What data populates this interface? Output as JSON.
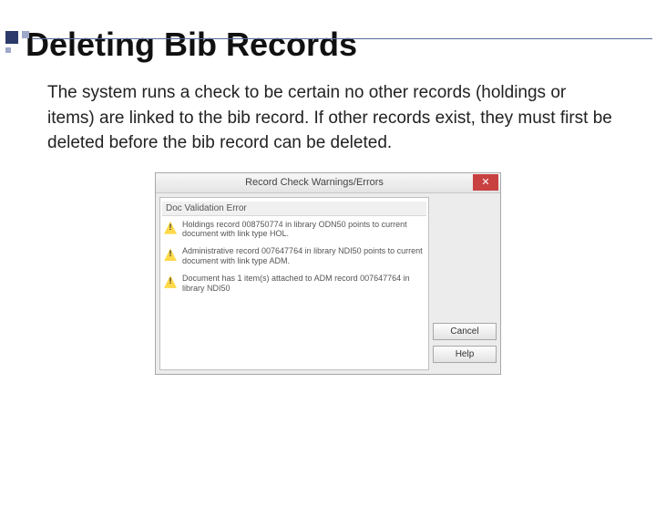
{
  "slide": {
    "title": "Deleting Bib Records",
    "body": "The system runs a check to be certain no other records (holdings or items) are linked to the bib record.  If other records exist, they must first be deleted before the bib record can be deleted."
  },
  "dialog": {
    "title": "Record Check Warnings/Errors",
    "close_glyph": "✕",
    "header": "Doc Validation Error",
    "messages": [
      "Holdings record 008750774 in library ODN50 points to current document with link type HOL.",
      "Administrative record 007647764 in library NDI50 points to current document with link type ADM.",
      "Document has 1 item(s) attached to ADM record 007647764 in library NDI50"
    ],
    "buttons": {
      "cancel": "Cancel",
      "help": "Help"
    }
  }
}
